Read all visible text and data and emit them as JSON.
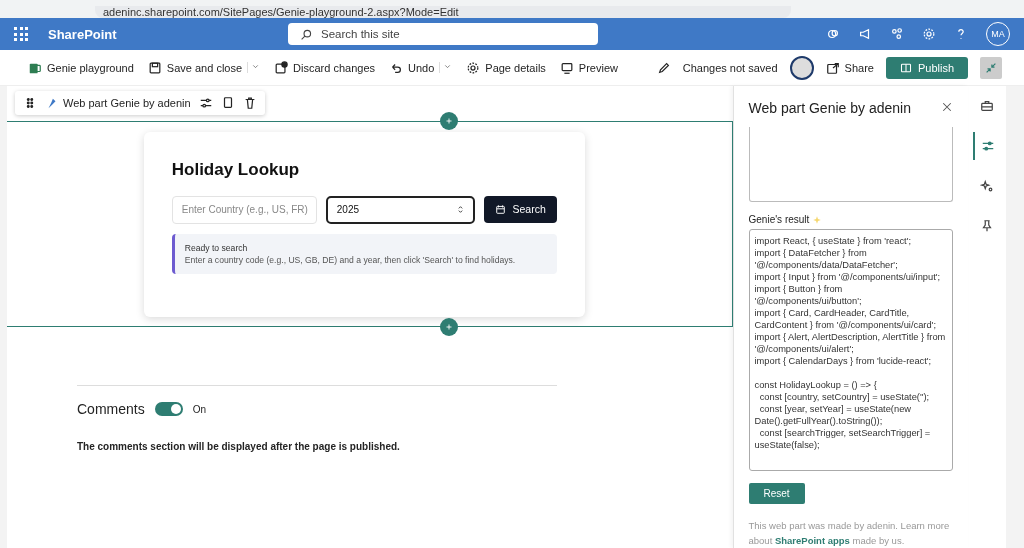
{
  "browser": {
    "url": "adeninc.sharepoint.com/SitePages/Genie-playground-2.aspx?Mode=Edit"
  },
  "suite_bar": {
    "app_name": "SharePoint",
    "search_placeholder": "Search this site",
    "avatar": "MA"
  },
  "command_bar": {
    "items": [
      {
        "kind": "page",
        "label": "Genie playground",
        "dropdown": false
      },
      {
        "kind": "save",
        "label": "Save and close",
        "dropdown": true
      },
      {
        "kind": "discard",
        "label": "Discard changes",
        "dropdown": false
      },
      {
        "kind": "undo",
        "label": "Undo",
        "dropdown": true
      },
      {
        "kind": "details",
        "label": "Page details",
        "dropdown": false
      },
      {
        "kind": "preview",
        "label": "Preview",
        "dropdown": false
      }
    ],
    "status": "Changes not saved",
    "share": "Share",
    "publish": "Publish"
  },
  "webpart_toolbar": {
    "label": "Web part Genie by adenin"
  },
  "holiday_card": {
    "title": "Holiday Lookup",
    "country_placeholder": "Enter Country (e.g., US, FR)",
    "year_value": "2025",
    "search_button": "Search",
    "alert_title": "Ready to search",
    "alert_text": "Enter a country code (e.g., US, GB, DE) and a year, then click 'Search' to find holidays."
  },
  "comments": {
    "title": "Comments",
    "on": true,
    "toggle_label": "On",
    "note": "The comments section will be displayed after the page is published."
  },
  "panel": {
    "title": "Web part Genie by adenin",
    "result_label": "Genie's result",
    "result_code": "import React, { useState } from 'react';\nimport { DataFetcher } from '@/components/data/DataFetcher';\nimport { Input } from '@/components/ui/input';\nimport { Button } from '@/components/ui/button';\nimport { Card, CardHeader, CardTitle, CardContent } from '@/components/ui/card';\nimport { Alert, AlertDescription, AlertTitle } from '@/components/ui/alert';\nimport { CalendarDays } from 'lucide-react';\n\nconst HolidayLookup = () => {\n  const [country, setCountry] = useState('');\n  const [year, setYear] = useState(new Date().getFullYear().toString());\n  const [searchTrigger, setSearchTrigger] = useState(false);",
    "reset": "Reset",
    "footer_before": "This web part was made by adenin. Learn more about ",
    "footer_link": "SharePoint apps",
    "footer_after": " made by us."
  },
  "rail": [
    {
      "kind": "toolbox",
      "selected": false
    },
    {
      "kind": "properties",
      "selected": true
    },
    {
      "kind": "design",
      "selected": false
    },
    {
      "kind": "pin",
      "selected": false
    }
  ]
}
